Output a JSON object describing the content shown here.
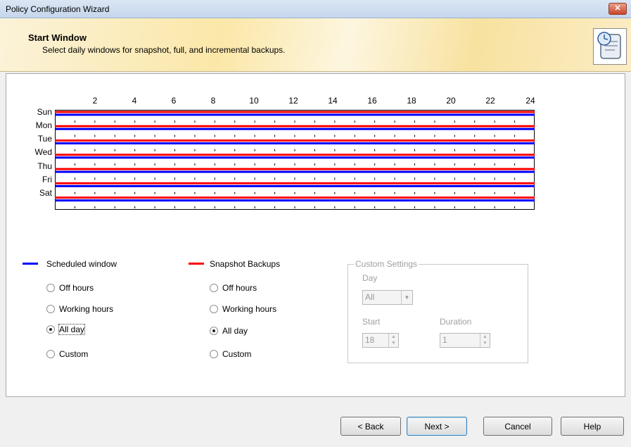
{
  "window": {
    "title": "Policy Configuration Wizard",
    "close_label": "✕"
  },
  "header": {
    "title": "Start Window",
    "subtitle": "Select daily windows for snapshot, full, and incremental backups."
  },
  "grid": {
    "hours": [
      "2",
      "4",
      "6",
      "8",
      "10",
      "12",
      "14",
      "16",
      "18",
      "20",
      "22",
      "24"
    ],
    "days": [
      "Sun",
      "Mon",
      "Tue",
      "Wed",
      "Thu",
      "Fri",
      "Sat"
    ],
    "scheduled_color": "#0000ff",
    "snapshot_color": "#ff0000"
  },
  "scheduled": {
    "legend": "Scheduled window",
    "options": [
      "Off hours",
      "Working hours",
      "All day",
      "Custom"
    ],
    "selected": "All day"
  },
  "snapshot": {
    "legend": "Snapshot  Backups",
    "options": [
      "Off hours",
      "Working hours",
      "All day",
      "Custom"
    ],
    "selected": "All day"
  },
  "custom": {
    "title": "Custom Settings",
    "day_label": "Day",
    "day_value": "All",
    "start_label": "Start",
    "start_value": "18",
    "duration_label": "Duration",
    "duration_value": "1"
  },
  "buttons": {
    "back": "< Back",
    "next": "Next >",
    "cancel": "Cancel",
    "help": "Help"
  }
}
